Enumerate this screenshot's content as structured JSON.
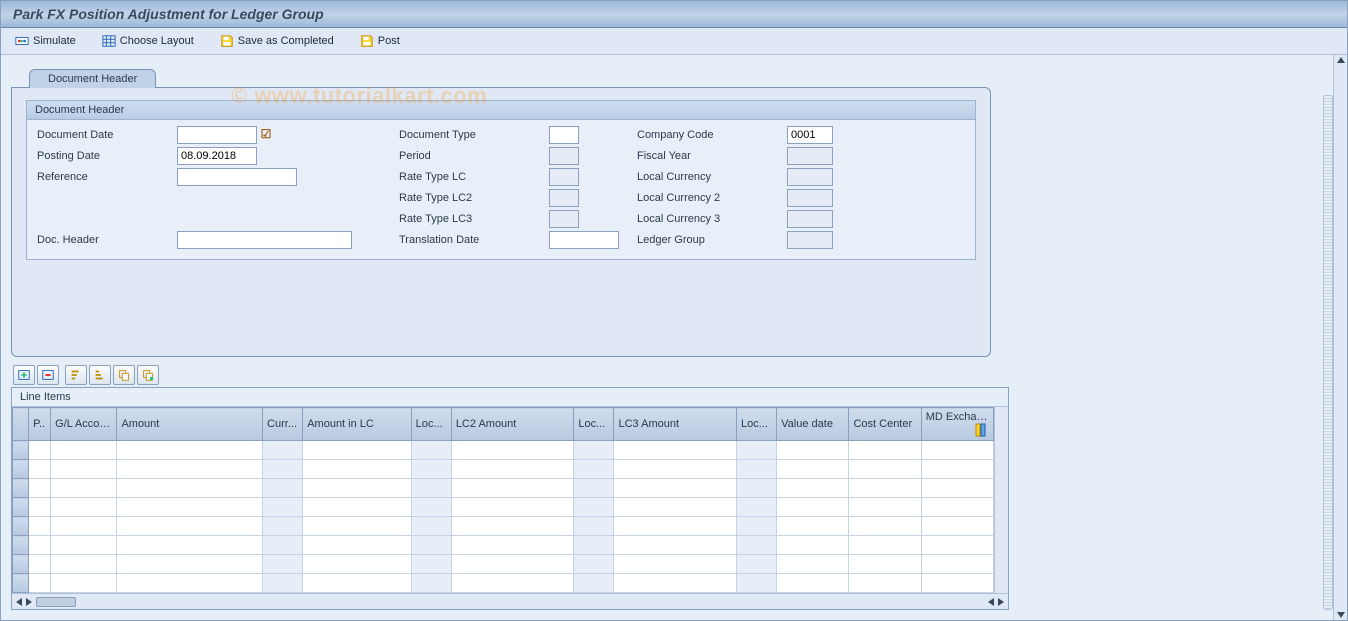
{
  "title": "Park FX Position Adjustment for Ledger Group",
  "watermark": "© www.tutorialkart.com",
  "toolbar": {
    "simulate": "Simulate",
    "choose_layout": "Choose Layout",
    "save_as_completed": "Save as Completed",
    "post": "Post"
  },
  "tab": {
    "document_header": "Document Header"
  },
  "group": {
    "document_header": "Document Header"
  },
  "labels": {
    "document_date": "Document Date",
    "document_type": "Document Type",
    "company_code": "Company Code",
    "posting_date": "Posting Date",
    "period": "Period",
    "fiscal_year": "Fiscal Year",
    "reference": "Reference",
    "rate_type_lc": "Rate Type LC",
    "local_currency": "Local Currency",
    "rate_type_lc2": "Rate Type LC2",
    "local_currency2": "Local Currency 2",
    "rate_type_lc3": "Rate Type LC3",
    "local_currency3": "Local Currency 3",
    "doc_header": "Doc. Header",
    "translation_date": "Translation Date",
    "ledger_group": "Ledger Group"
  },
  "values": {
    "document_date": "",
    "document_type": "",
    "company_code": "0001",
    "posting_date": "08.09.2018",
    "period": "",
    "fiscal_year": "",
    "reference": "",
    "rate_type_lc": "",
    "local_currency": "",
    "rate_type_lc2": "",
    "local_currency2": "",
    "rate_type_lc3": "",
    "local_currency3": "",
    "doc_header": "",
    "translation_date": "",
    "ledger_group": ""
  },
  "line_items": {
    "title": "Line Items",
    "columns": [
      "P..",
      "G/L Account",
      "Amount",
      "Curr...",
      "Amount in LC",
      "Loc...",
      "LC2 Amount",
      "Loc...",
      "LC3 Amount",
      "Loc...",
      "Value date",
      "Cost Center",
      "MD Exchange"
    ],
    "row_count": 8
  }
}
